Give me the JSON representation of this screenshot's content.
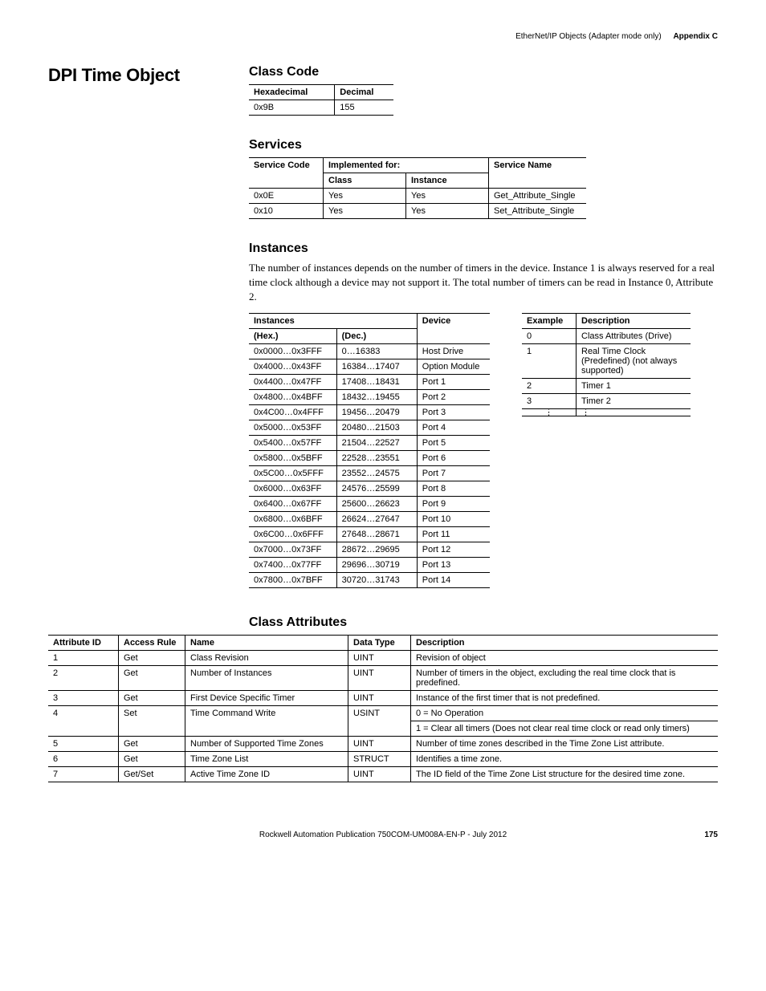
{
  "header": {
    "section": "EtherNet/IP Objects (Adapter mode only)",
    "appendix": "Appendix C"
  },
  "page_title": "DPI Time Object",
  "class_code": {
    "heading": "Class Code",
    "cols": [
      "Hexadecimal",
      "Decimal"
    ],
    "row": [
      "0x9B",
      "155"
    ]
  },
  "services": {
    "heading": "Services",
    "head_top": [
      "Service Code",
      "Implemented for:",
      "Service Name"
    ],
    "head_sub": [
      "Class",
      "Instance"
    ],
    "rows": [
      [
        "0x0E",
        "Yes",
        "Yes",
        "Get_Attribute_Single"
      ],
      [
        "0x10",
        "Yes",
        "Yes",
        "Set_Attribute_Single"
      ]
    ]
  },
  "instances": {
    "heading": "Instances",
    "intro": "The number of instances depends on the number of timers in the device. Instance 1 is always reserved for a real time clock although a device may not support it. The total number of timers can be read in Instance 0, Attribute 2.",
    "left_head_top": [
      "Instances",
      "Device"
    ],
    "left_head_sub": [
      "(Hex.)",
      "(Dec.)"
    ],
    "left_rows": [
      [
        "0x0000…0x3FFF",
        "0…16383",
        "Host Drive"
      ],
      [
        "0x4000…0x43FF",
        "16384…17407",
        "Option Module"
      ],
      [
        "0x4400…0x47FF",
        "17408…18431",
        "Port 1"
      ],
      [
        "0x4800…0x4BFF",
        "18432…19455",
        "Port 2"
      ],
      [
        "0x4C00…0x4FFF",
        "19456…20479",
        "Port 3"
      ],
      [
        "0x5000…0x53FF",
        "20480…21503",
        "Port 4"
      ],
      [
        "0x5400…0x57FF",
        "21504…22527",
        "Port 5"
      ],
      [
        "0x5800…0x5BFF",
        "22528…23551",
        "Port 6"
      ],
      [
        "0x5C00…0x5FFF",
        "23552…24575",
        "Port 7"
      ],
      [
        "0x6000…0x63FF",
        "24576…25599",
        "Port 8"
      ],
      [
        "0x6400…0x67FF",
        "25600…26623",
        "Port 9"
      ],
      [
        "0x6800…0x6BFF",
        "26624…27647",
        "Port 10"
      ],
      [
        "0x6C00…0x6FFF",
        "27648…28671",
        "Port 11"
      ],
      [
        "0x7000…0x73FF",
        "28672…29695",
        "Port 12"
      ],
      [
        "0x7400…0x77FF",
        "29696…30719",
        "Port 13"
      ],
      [
        "0x7800…0x7BFF",
        "30720…31743",
        "Port 14"
      ]
    ],
    "right_head": [
      "Example",
      "Description"
    ],
    "right_rows": [
      [
        "0",
        "Class Attributes (Drive)"
      ],
      [
        "1",
        "Real Time Clock (Predefined) (not always supported)"
      ],
      [
        "2",
        "Timer 1"
      ],
      [
        "3",
        "Timer 2"
      ]
    ]
  },
  "class_attrs": {
    "heading": "Class Attributes",
    "cols": [
      "Attribute ID",
      "Access Rule",
      "Name",
      "Data Type",
      "Description"
    ],
    "rows": [
      [
        "1",
        "Get",
        "Class Revision",
        "UINT",
        "Revision of object"
      ],
      [
        "2",
        "Get",
        "Number of Instances",
        "UINT",
        "Number of timers in the object, excluding the real time clock that is predefined."
      ],
      [
        "3",
        "Get",
        "First Device Specific Timer",
        "UINT",
        "Instance of the first timer that is not predefined."
      ],
      [
        "4",
        "Set",
        "Time Command Write",
        "USINT",
        "0 = No Operation\n1 = Clear all timers (Does not clear real time clock or read only timers)"
      ],
      [
        "5",
        "Get",
        "Number of Supported Time Zones",
        "UINT",
        "Number of time zones described in the Time Zone List attribute."
      ],
      [
        "6",
        "Get",
        "Time Zone List",
        "STRUCT",
        "Identifies a time zone."
      ],
      [
        "7",
        "Get/Set",
        "Active Time Zone ID",
        "UINT",
        "The ID field of the Time Zone List structure for the desired time zone."
      ]
    ]
  },
  "footer": {
    "pub": "Rockwell Automation Publication 750COM-UM008A-EN-P - July 2012",
    "page": "175"
  }
}
